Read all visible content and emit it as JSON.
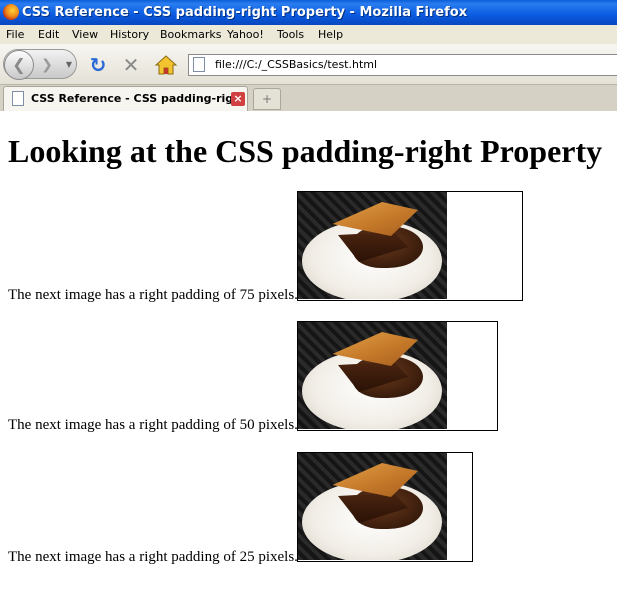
{
  "window": {
    "title": "CSS Reference - CSS padding-right Property - Mozilla Firefox"
  },
  "menu": {
    "items": [
      "File",
      "Edit",
      "View",
      "History",
      "Bookmarks",
      "Yahoo!",
      "Tools",
      "Help"
    ]
  },
  "nav": {
    "url": "file:///C:/_CSSBasics/test.html",
    "back_icon": "back-arrow-icon",
    "forward_icon": "forward-arrow-icon",
    "reload_icon": "reload-icon",
    "stop_icon": "stop-icon",
    "home_icon": "home-icon"
  },
  "tabs": {
    "active_label": "CSS Reference - CSS padding-rig...",
    "close_icon": "close-tab-icon",
    "new_tab_icon": "new-tab-icon"
  },
  "page": {
    "heading": "Looking at the CSS padding-right Property",
    "rows": [
      {
        "caption": "The next image has a right padding of 75 pixels.",
        "padding_right": 75,
        "image": "pie-photo"
      },
      {
        "caption": "The next image has a right padding of 50 pixels.",
        "padding_right": 50,
        "image": "pie-photo"
      },
      {
        "caption": "The next image has a right padding of 25 pixels.",
        "padding_right": 25,
        "image": "pie-photo"
      }
    ]
  },
  "colors": {
    "titlebar": "#0a5ae0",
    "chrome": "#ece9d8",
    "tab_close": "#d04040"
  }
}
